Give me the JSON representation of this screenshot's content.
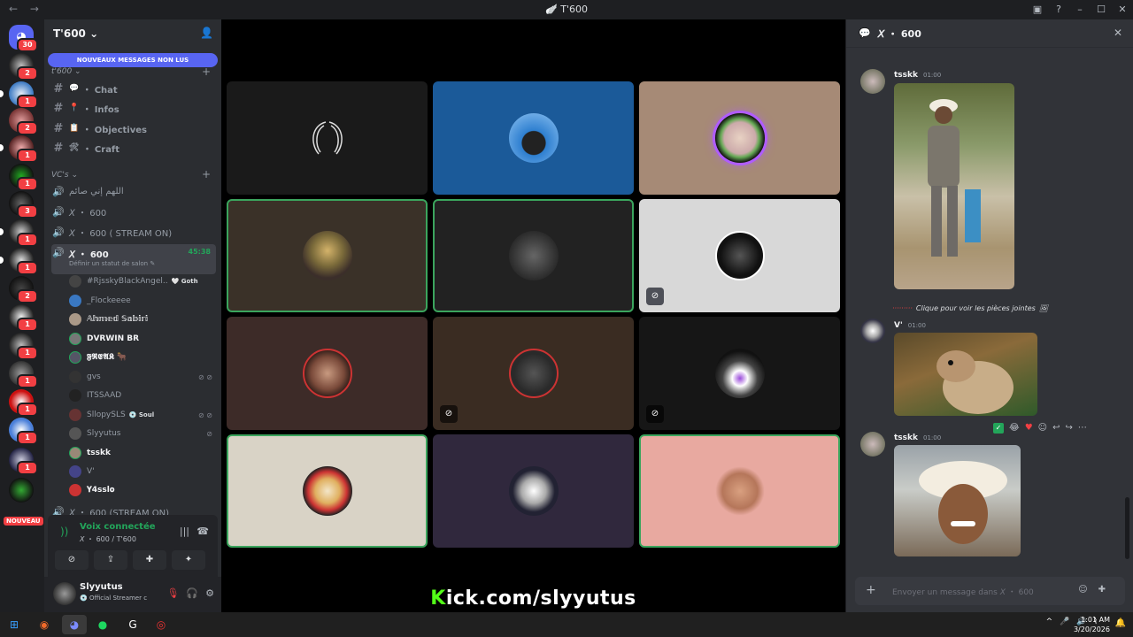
{
  "window": {
    "title": "T'600",
    "back": "←",
    "forward": "→"
  },
  "servers": {
    "home_badge": "30",
    "badges": [
      "2",
      "1",
      "2",
      "1",
      "1",
      "3",
      "1",
      "1",
      "2",
      "1",
      "1",
      "1",
      "1",
      "1",
      "1"
    ],
    "new_label": "NOUVEAU"
  },
  "guild": {
    "name": "T'600 ⌄",
    "new_messages_banner": "NOUVEAUX MESSAGES NON LUS",
    "category_text": "t'600 ⌄",
    "text_channels": [
      {
        "emoji": "💬",
        "name": "・ Chat"
      },
      {
        "emoji": "📍",
        "name": "・ Infos"
      },
      {
        "emoji": "📋",
        "name": "・ Objectives"
      },
      {
        "emoji": "🛠",
        "name": "・ Craft"
      }
    ],
    "category_voice": "VC's ⌄",
    "voice_channels": [
      {
        "name": "اللهم إني صائم"
      },
      {
        "name": "𝘟 ・ 600"
      },
      {
        "name": "𝘟 ・ 600 ( STREAM ON)"
      }
    ],
    "active_voice": {
      "name": "𝘟 ・ 600",
      "time": "45:38",
      "status": "Définir un statut de salon ✎"
    },
    "members": [
      {
        "name": "#RjsskyBlackAngel..",
        "tag": "🤍 Goth"
      },
      {
        "name": "_Flockeeee",
        "tag": ""
      },
      {
        "name": "𝔸𝕙𝕞𝕖𝕕 𝕊𝕒𝕓𝕚𝕣𝕚",
        "tag": ""
      },
      {
        "name": "DVRWIN BR",
        "tag": ""
      },
      {
        "name": "𝕱𝕽𝕰𝕬𝕶 🐂",
        "tag": ""
      },
      {
        "name": "gvs",
        "tag": ""
      },
      {
        "name": "ITSSAAD",
        "tag": ""
      },
      {
        "name": "SllopySLS",
        "tag": "💿 Soul"
      },
      {
        "name": "Slyyutus",
        "tag": ""
      },
      {
        "name": "tsskk",
        "tag": ""
      },
      {
        "name": "V'",
        "tag": ""
      },
      {
        "name": "𝐘4ssl𝐨",
        "tag": ""
      }
    ],
    "bottom_channel": "𝘟 ・ 600 (STREAM ON)"
  },
  "voice_panel": {
    "title": "Voix connectée",
    "subtitle": "𝘟 ・ 600 / T'600"
  },
  "user": {
    "name": "Slyyutus",
    "status": "💿 Official Streamer c"
  },
  "stage": {
    "watermark_k": "K",
    "watermark_rest": "ick.com/slyyutus"
  },
  "thread": {
    "title": "𝘟 ・ 600",
    "messages": [
      {
        "author": "tsskk",
        "time": "01:00"
      },
      {
        "author": "V'",
        "time": "01:00"
      },
      {
        "author": "tsskk",
        "time": "01:00"
      }
    ],
    "reply_text": "Clique pour voir les pièces jointes",
    "reply_author": "·········",
    "composer_placeholder": "Envoyer un message dans 𝘟 ・ 600"
  },
  "taskbar": {
    "time": "1:01 AM",
    "date": "3/20/2026"
  },
  "colors": {
    "accent": "#5865f2",
    "online": "#23a55a",
    "danger": "#f23f43",
    "kick_green": "#53fc18"
  }
}
